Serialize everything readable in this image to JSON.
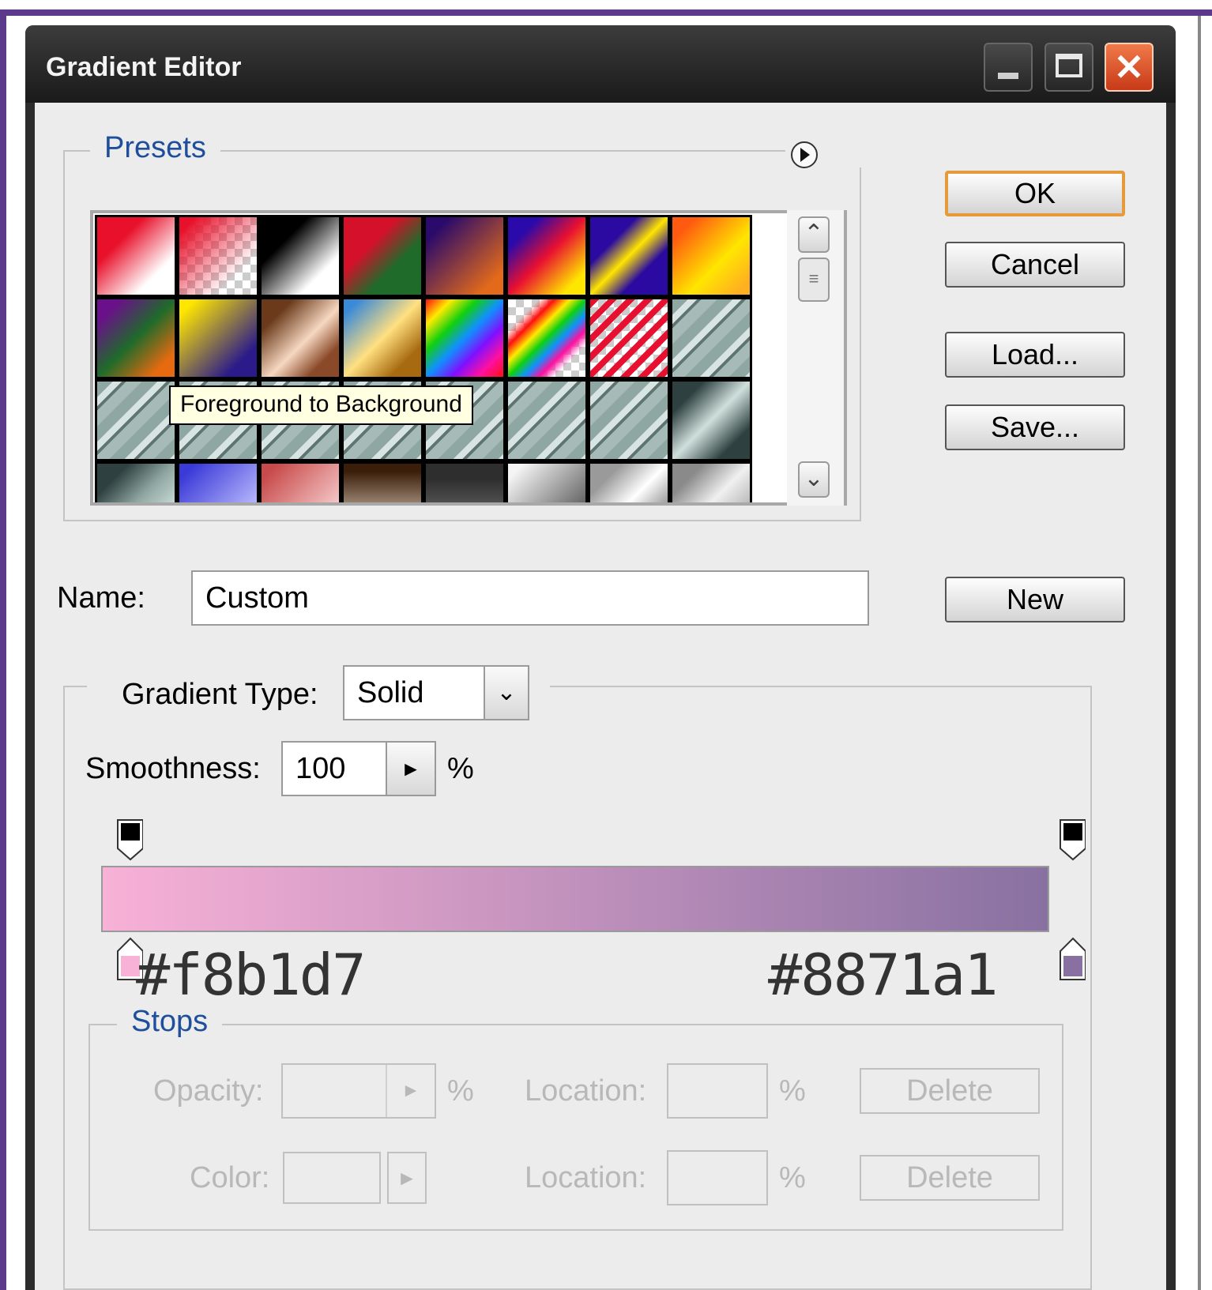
{
  "window": {
    "title": "Gradient Editor"
  },
  "colors": {
    "frame_accent": "#5b3a8c",
    "gradient_start": "#f8b1d7",
    "gradient_end": "#8871a1",
    "group_label": "#1f4e9c"
  },
  "presets": {
    "label": "Presets",
    "menu_icon": "arrow-circle-icon",
    "tooltip": "Foreground to Background",
    "scroll_up_icon": "chevron-up-icon",
    "scroll_down_icon": "chevron-down-icon",
    "swatch_count": 32
  },
  "buttons": {
    "ok": "OK",
    "cancel": "Cancel",
    "load": "Load...",
    "save": "Save...",
    "new": "New"
  },
  "name": {
    "label": "Name:",
    "value": "Custom"
  },
  "gradient_type": {
    "label": "Gradient Type:",
    "value": "Solid"
  },
  "smoothness": {
    "label": "Smoothness:",
    "value": "100",
    "unit": "%"
  },
  "gradient_bar": {
    "start_hex": "#f8b1d7",
    "end_hex": "#8871a1"
  },
  "stops": {
    "label": "Stops",
    "opacity_label": "Opacity:",
    "opacity_unit": "%",
    "location_label_1": "Location:",
    "location_unit_1": "%",
    "delete_1": "Delete",
    "color_label": "Color:",
    "location_label_2": "Location:",
    "location_unit_2": "%",
    "delete_2": "Delete"
  }
}
